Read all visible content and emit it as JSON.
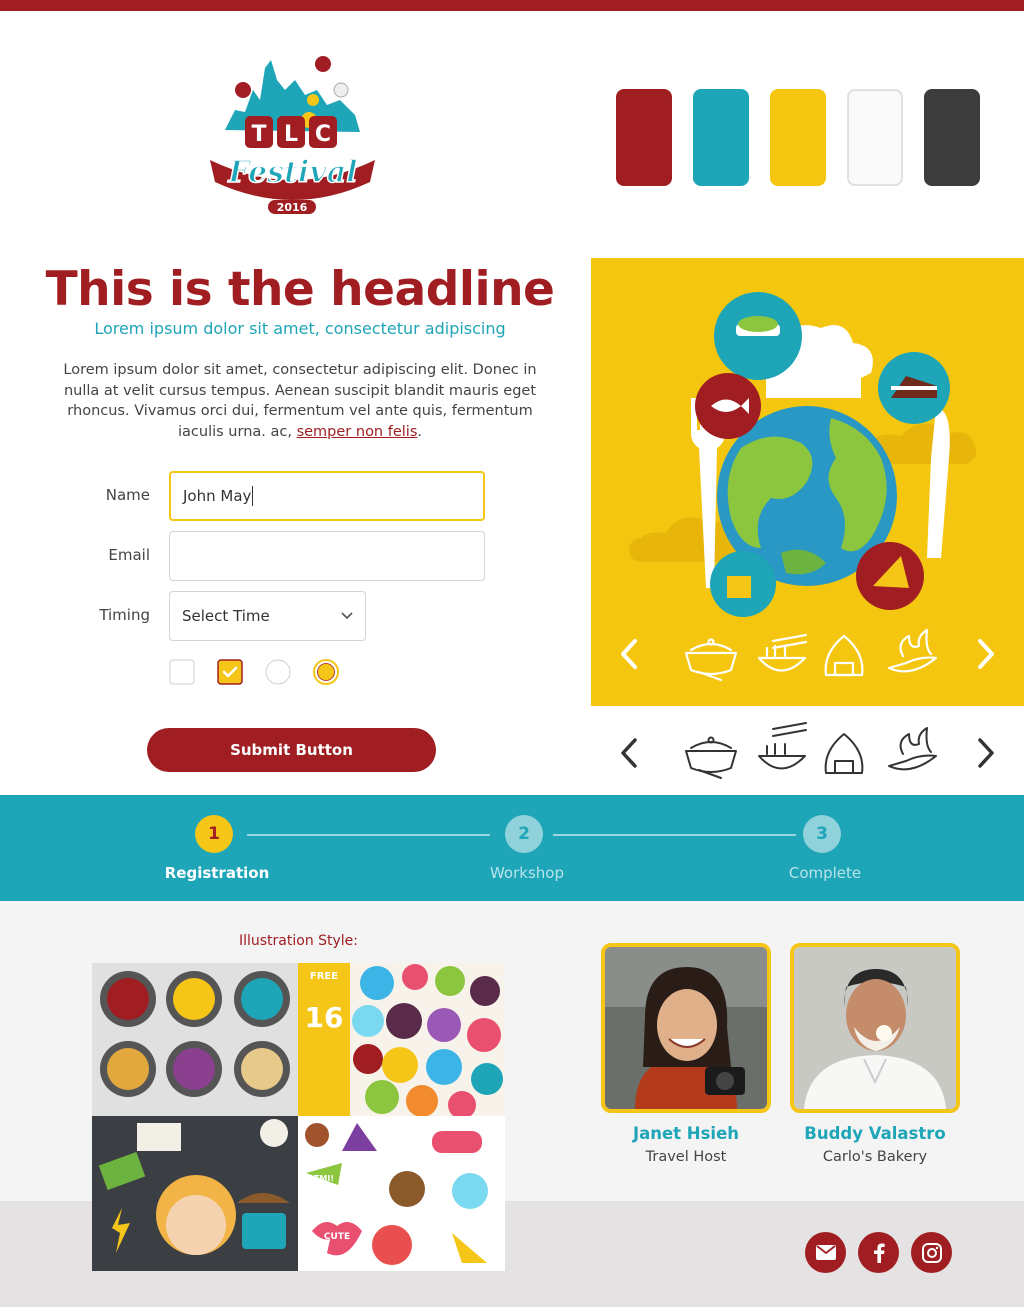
{
  "logo": {
    "brand": "TLC",
    "event": "Festival",
    "year": "2016"
  },
  "palette": {
    "swatches": [
      "#a01e21",
      "#1ea5b8",
      "#f5c60f",
      "#fafafa",
      "#3c3c3c"
    ]
  },
  "hero": {
    "headline": "This is the headline",
    "subheadline": "Lorem ipsum dolor sit amet, consectetur adipiscing",
    "body": "Lorem ipsum dolor sit amet, consectetur adipiscing elit. Donec in nulla at velit cursus tempus. Aenean suscipit blandit mauris eget rhoncus. Vivamus orci dui, fermentum vel ante quis, fermentum iaculis urna. ac,",
    "link_text": "semper non felis",
    "body_end": "."
  },
  "form": {
    "name_label": "Name",
    "name_value": "John May",
    "email_label": "Email",
    "email_value": "",
    "timing_label": "Timing",
    "timing_value": "Select Time",
    "checkbox_unchecked": false,
    "checkbox_checked": true,
    "radio_unselected": false,
    "radio_selected": true,
    "submit_label": "Submit Button"
  },
  "carousel": {
    "icons": [
      "pot-icon",
      "noodle-bowl-icon",
      "rice-ball-icon",
      "chili-pepper-icon"
    ]
  },
  "stepper": {
    "steps": [
      {
        "number": "1",
        "label": "Registration",
        "state": "active"
      },
      {
        "number": "2",
        "label": "Workshop",
        "state": "inactive"
      },
      {
        "number": "3",
        "label": "Complete",
        "state": "inactive"
      }
    ]
  },
  "illustrations": {
    "title": "Illustration Style:",
    "tile_text": {
      "free": "FREE",
      "count": "16",
      "tmi": "TMI!",
      "cute": "CUTE"
    }
  },
  "people": [
    {
      "name": "Janet Hsieh",
      "role": "Travel Host"
    },
    {
      "name": "Buddy Valastro",
      "role": "Carlo's Bakery"
    }
  ],
  "social": [
    "email-icon",
    "facebook-icon",
    "instagram-icon"
  ]
}
